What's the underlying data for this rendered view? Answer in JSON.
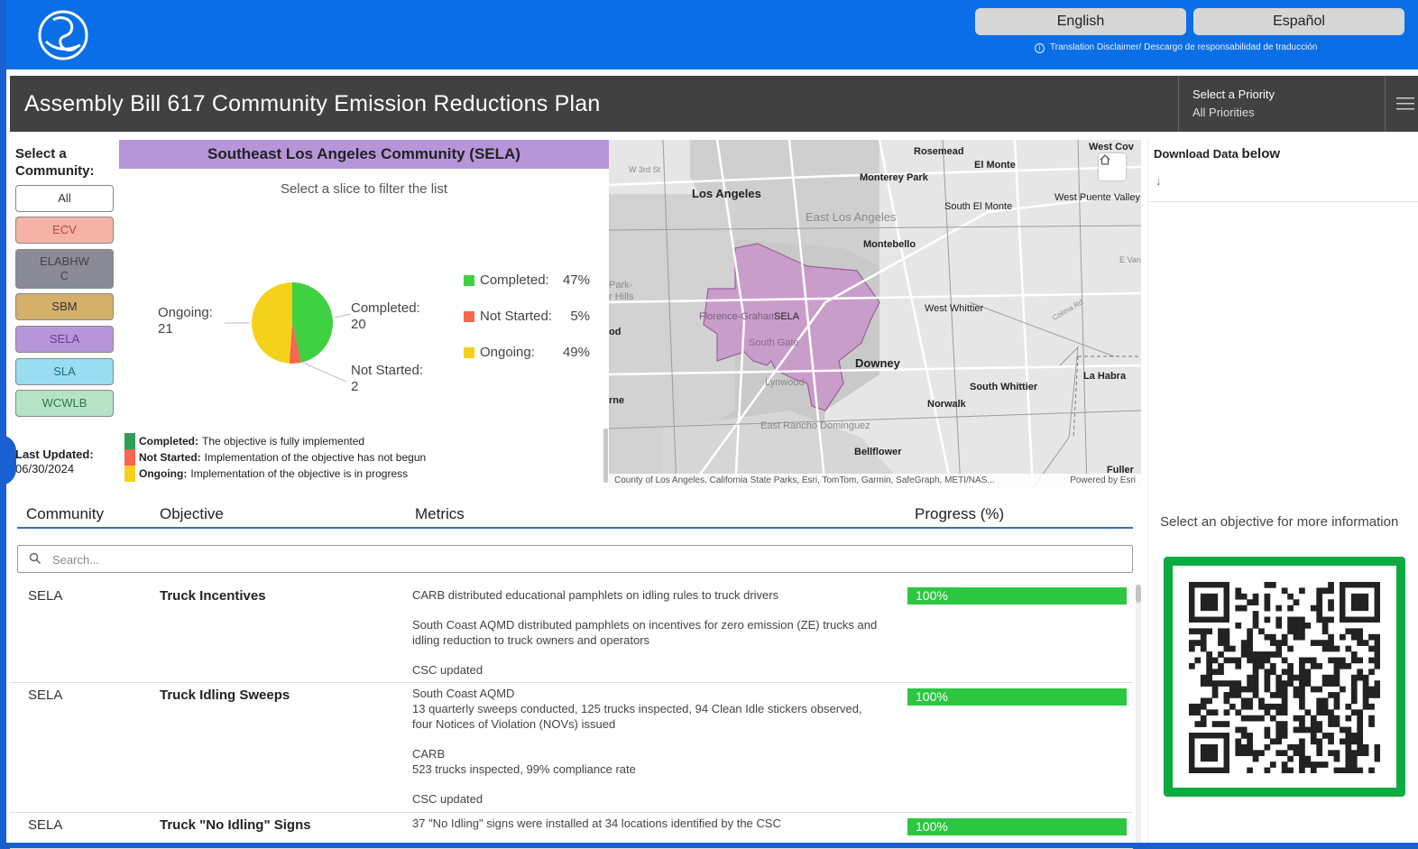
{
  "header": {
    "english_label": "English",
    "espanol_label": "Español",
    "disclaimer": "Translation Disclaimer/ Descargo de responsabilidad de traducción"
  },
  "title_bar": {
    "title": "Assembly Bill 617 Community Emission Reductions Plan",
    "priority_label": "Select a Priority",
    "priority_value": "All Priorities"
  },
  "communities": {
    "heading": "Select a Community:",
    "buttons": [
      {
        "label": "All",
        "color": "#ffffff"
      },
      {
        "label": "ECV",
        "color": "#f5b2a6"
      },
      {
        "label": "ELABHWC",
        "color": "#8b8b98"
      },
      {
        "label": "SBM",
        "color": "#d5b06a"
      },
      {
        "label": "SELA",
        "color": "#b695d9"
      },
      {
        "label": "SLA",
        "color": "#9adcf0"
      },
      {
        "label": "WCWLB",
        "color": "#b6e3c6"
      }
    ],
    "last_updated_label": "Last Updated:",
    "last_updated_date": "06/30/2024"
  },
  "chart_panel": {
    "heading": "Southeast Los Angeles Community (SELA)",
    "hint": "Select a slice to filter the list",
    "pie_labels": {
      "ongoing_name": "Ongoing:",
      "ongoing_count": "21",
      "completed_name": "Completed:",
      "completed_count": "20",
      "not_started_name": "Not Started:",
      "not_started_count": "2"
    },
    "legend": [
      {
        "name": "Completed:",
        "pct": "47%",
        "color": "#3fd142"
      },
      {
        "name": "Not Started:",
        "pct": "5%",
        "color": "#f5674e"
      },
      {
        "name": "Ongoing:",
        "pct": "49%",
        "color": "#f5d21a"
      }
    ],
    "key": [
      {
        "term": "Completed:",
        "desc": "The objective is fully implemented",
        "color": "#2f9e57"
      },
      {
        "term": "Not Started:",
        "desc": "Implementation of the objective has not begun",
        "color": "#f5674e"
      },
      {
        "term": "Ongoing:",
        "desc": "Implementation of the objective is in progress",
        "color": "#f5d21a"
      }
    ]
  },
  "chart_data": {
    "type": "pie",
    "categories": [
      "Completed",
      "Not Started",
      "Ongoing"
    ],
    "values": [
      20,
      2,
      21
    ],
    "percentages": [
      47,
      5,
      49
    ],
    "colors": [
      "#3fd142",
      "#f5674e",
      "#f5d21a"
    ]
  },
  "map": {
    "labels": {
      "los_angeles": "Los Angeles",
      "rosemead": "Rosemead",
      "west_cov": "West Cov",
      "el_monte": "El Monte",
      "monterey_park": "Monterey Park",
      "south_el_monte": "South El Monte",
      "west_puente_valley": "West Puente Valley",
      "east_los_angeles": "East Los Angeles",
      "montebello": "Montebello",
      "sela": "SELA",
      "florence_graham": "Florence-Graham",
      "south_gate": "South Gate",
      "west_whittier": "West Whittier",
      "downey": "Downey",
      "lynwood": "Lynwood",
      "south_whittier": "South Whittier",
      "la_habra": "La Habra",
      "norwalk": "Norwalk",
      "east_rancho_dominguez": "East Rancho Dominguez",
      "bellflower": "Bellflower",
      "fuller": "Fuller",
      "park_hills": "Park-\nr Hills",
      "od": "od",
      "rne": "rne",
      "w3rd": "W 3rd St",
      "e_van": "E Van",
      "colima": "Colima Rd"
    },
    "attribution": "County of Los Angeles, California State Parks, Esri, TomTom, Garmin, SafeGraph, METI/NAS...",
    "powered": "Powered by Esri"
  },
  "right_panel": {
    "download_prefix": "Download Data",
    "download_suffix": "below",
    "download_icon": "↓",
    "select_hint": "Select an objective for more information"
  },
  "table": {
    "columns": [
      "Community",
      "Objective",
      "Metrics",
      "Progress (%)"
    ],
    "search_placeholder": "Search...",
    "rows": [
      {
        "community": "SELA",
        "objective": "Truck Incentives",
        "metrics": [
          "CARB distributed educational pamphlets on idling rules to truck drivers",
          "South Coast AQMD distributed pamphlets on incentives for zero emission (ZE) trucks and idling reduction to truck owners and operators",
          "CSC updated"
        ],
        "progress": "100%",
        "progress_value": 100
      },
      {
        "community": "SELA",
        "objective": "Truck Idling Sweeps",
        "metrics": [
          "South Coast AQMD\n13 quarterly sweeps conducted, 125 trucks inspected, 94 Clean Idle stickers observed, four Notices of Violation (NOVs) issued",
          "CARB\n523 trucks inspected, 99% compliance rate",
          "CSC updated"
        ],
        "progress": "100%",
        "progress_value": 100
      },
      {
        "community": "SELA",
        "objective": "Truck \"No Idling\" Signs",
        "metrics": [
          "37 \"No Idling\" signs were installed at 34 locations identified by the CSC"
        ],
        "progress": "100%",
        "progress_value": 100
      }
    ]
  }
}
